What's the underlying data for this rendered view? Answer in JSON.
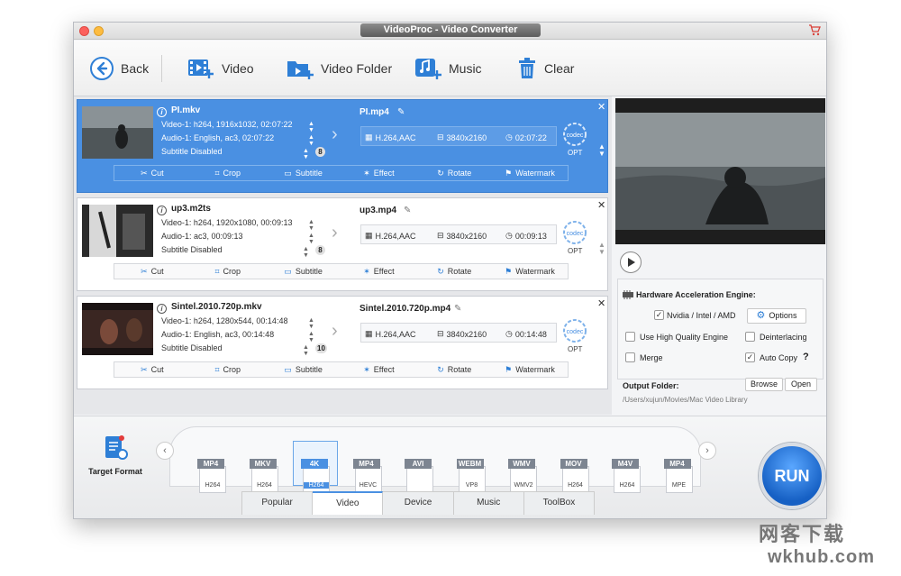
{
  "window": {
    "title": "VideoProc - Video Converter"
  },
  "toolbar": {
    "back_label": "Back",
    "video_label": "Video",
    "video_folder_label": "Video Folder",
    "music_label": "Music",
    "clear_label": "Clear"
  },
  "files": [
    {
      "name": "PI.mkv",
      "video": "Video-1: h264, 1916x1032, 02:07:22",
      "audio": "Audio-1: English, ac3, 02:07:22",
      "subtitle": "Subtitle Disabled",
      "count": "8",
      "output_name": "PI.mp4",
      "codec": "H.264,AAC",
      "resolution": "3840x2160",
      "duration": "02:07:22"
    },
    {
      "name": "up3.m2ts",
      "video": "Video-1: h264, 1920x1080, 00:09:13",
      "audio": "Audio-1: ac3, 00:09:13",
      "subtitle": "Subtitle Disabled",
      "count": "8",
      "output_name": "up3.mp4",
      "codec": "H.264,AAC",
      "resolution": "3840x2160",
      "duration": "00:09:13"
    },
    {
      "name": "Sintel.2010.720p.mkv",
      "video": "Video-1: h264, 1280x544, 00:14:48",
      "audio": "Audio-1: English, ac3, 00:14:48",
      "subtitle": "Subtitle Disabled",
      "count": "10",
      "output_name": "Sintel.2010.720p.mp4",
      "codec": "H.264,AAC",
      "resolution": "3840x2160",
      "duration": "00:14:48"
    }
  ],
  "file_common": {
    "opt_label": "OPT",
    "codec_icon_text": "codec",
    "edit": {
      "cut": "Cut",
      "crop": "Crop",
      "subtitle": "Subtitle",
      "effect": "Effect",
      "rotate": "Rotate",
      "watermark": "Watermark"
    }
  },
  "settings": {
    "hw_title": "Hardware Acceleration Engine:",
    "nvidia": "Nvidia / Intel / AMD",
    "options": "Options",
    "high_quality": "Use High Quality Engine",
    "deinterlacing": "Deinterlacing",
    "merge": "Merge",
    "auto_copy": "Auto Copy",
    "help": "?"
  },
  "output": {
    "label": "Output Folder:",
    "path": "/Users/xujun/Movies/Mac Video Library",
    "browse": "Browse",
    "open": "Open"
  },
  "format": {
    "target_label": "Target Format",
    "items": [
      {
        "tag": "MP4",
        "sub": "H264"
      },
      {
        "tag": "MKV",
        "sub": "H264"
      },
      {
        "tag": "4K",
        "sub": "H264"
      },
      {
        "tag": "MP4",
        "sub": "HEVC"
      },
      {
        "tag": "AVI",
        "sub": ""
      },
      {
        "tag": "WEBM",
        "sub": "VP8"
      },
      {
        "tag": "WMV",
        "sub": "WMV2"
      },
      {
        "tag": "MOV",
        "sub": "H264"
      },
      {
        "tag": "M4V",
        "sub": "H264"
      },
      {
        "tag": "MP4",
        "sub": "MPE"
      }
    ],
    "selected_index": 2,
    "tabs": [
      "Popular",
      "Video",
      "Device",
      "Music",
      "ToolBox"
    ],
    "active_tab": 1
  },
  "run_label": "RUN",
  "watermark_cn": "网客下载",
  "watermark_en": "wkhub.com",
  "colors": {
    "accent": "#4a90e2",
    "run": "#1660c4"
  }
}
